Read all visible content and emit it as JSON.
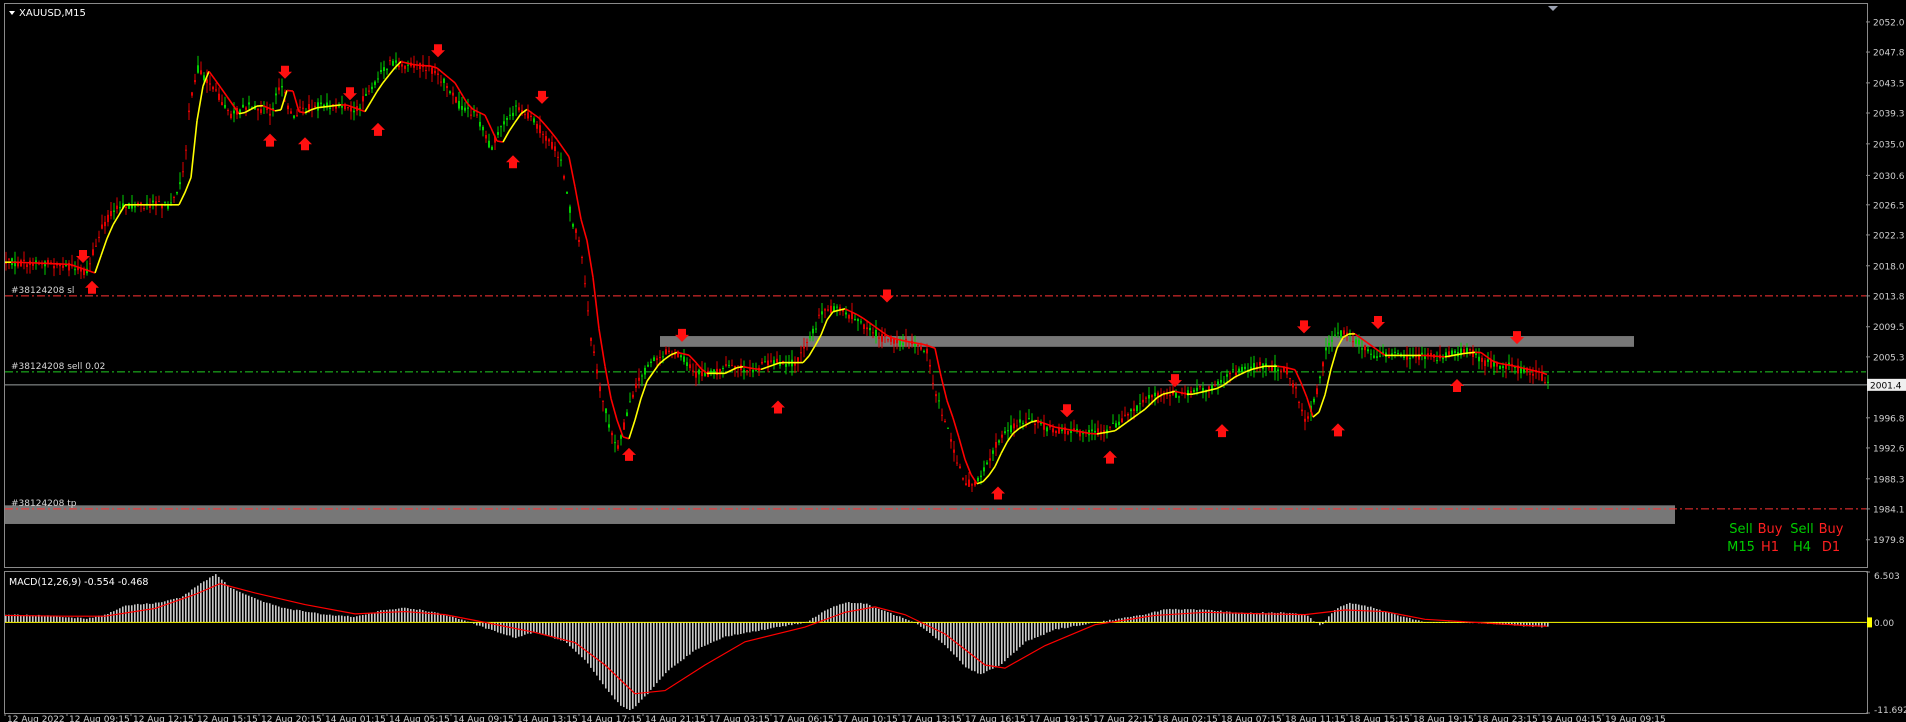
{
  "chart_data": [
    {
      "type": "candlestick",
      "symbol_label": "XAUUSD,M15",
      "ylim": [
        1976.0,
        2054.5
      ],
      "y_ticks": [
        "2052.0",
        "2047.8",
        "2043.5",
        "2039.3",
        "2035.0",
        "2030.6",
        "2026.5",
        "2022.3",
        "2018.0",
        "2013.8",
        "2009.5",
        "2005.3",
        "2001.4",
        "1996.8",
        "1992.6",
        "1988.3",
        "1984.1",
        "1979.8"
      ],
      "current_price_label": "2001.4",
      "x_ticks": [
        "12 Aug 2022",
        "12 Aug 09:15",
        "12 Aug 12:15",
        "12 Aug 15:15",
        "12 Aug 20:15",
        "14 Aug 01:15",
        "14 Aug 05:15",
        "14 Aug 09:15",
        "14 Aug 13:15",
        "14 Aug 17:15",
        "14 Aug 21:15",
        "17 Aug 03:15",
        "17 Aug 06:15",
        "17 Aug 10:15",
        "17 Aug 13:15",
        "17 Aug 16:15",
        "17 Aug 19:15",
        "17 Aug 22:15",
        "18 Aug 02:15",
        "18 Aug 07:15",
        "18 Aug 11:15",
        "18 Aug 15:15",
        "18 Aug 19:15",
        "18 Aug 23:15",
        "19 Aug 04:15",
        "19 Aug 09:15"
      ],
      "price_path": [
        [
          0,
          2018.5
        ],
        [
          55,
          2018.2
        ],
        [
          80,
          2017.0
        ],
        [
          95,
          2023.0
        ],
        [
          110,
          2026.5
        ],
        [
          165,
          2026.5
        ],
        [
          178,
          2031.0
        ],
        [
          183,
          2040.0
        ],
        [
          192,
          2045.5
        ],
        [
          205,
          2043.0
        ],
        [
          225,
          2039.0
        ],
        [
          245,
          2040.5
        ],
        [
          265,
          2039.3
        ],
        [
          275,
          2043.8
        ],
        [
          285,
          2039.0
        ],
        [
          300,
          2040.0
        ],
        [
          330,
          2040.5
        ],
        [
          350,
          2039.5
        ],
        [
          365,
          2043.0
        ],
        [
          385,
          2046.5
        ],
        [
          400,
          2046.0
        ],
        [
          420,
          2045.8
        ],
        [
          440,
          2043.5
        ],
        [
          455,
          2040.0
        ],
        [
          470,
          2039.0
        ],
        [
          485,
          2034.5
        ],
        [
          495,
          2037.0
        ],
        [
          510,
          2040.0
        ],
        [
          525,
          2038.5
        ],
        [
          540,
          2036.0
        ],
        [
          555,
          2033.0
        ],
        [
          565,
          2025.0
        ],
        [
          575,
          2020.0
        ],
        [
          585,
          2008.0
        ],
        [
          595,
          2000.0
        ],
        [
          605,
          1995.0
        ],
        [
          612,
          1993.0
        ],
        [
          620,
          1996.5
        ],
        [
          630,
          2001.5
        ],
        [
          645,
          2004.5
        ],
        [
          660,
          2006.0
        ],
        [
          675,
          2005.5
        ],
        [
          690,
          2003.0
        ],
        [
          710,
          2003.0
        ],
        [
          725,
          2004.0
        ],
        [
          745,
          2003.5
        ],
        [
          765,
          2004.5
        ],
        [
          790,
          2004.5
        ],
        [
          805,
          2008.0
        ],
        [
          815,
          2011.5
        ],
        [
          830,
          2012.0
        ],
        [
          845,
          2011.0
        ],
        [
          860,
          2009.5
        ],
        [
          875,
          2008.0
        ],
        [
          890,
          2007.5
        ],
        [
          910,
          2007.0
        ],
        [
          920,
          2006.5
        ],
        [
          930,
          2000.0
        ],
        [
          940,
          1996.0
        ],
        [
          950,
          1991.0
        ],
        [
          960,
          1987.5
        ],
        [
          970,
          1988.0
        ],
        [
          980,
          1990.0
        ],
        [
          990,
          1993.0
        ],
        [
          1000,
          1995.0
        ],
        [
          1020,
          1996.5
        ],
        [
          1040,
          1995.5
        ],
        [
          1060,
          1995.0
        ],
        [
          1080,
          1994.5
        ],
        [
          1100,
          1995.0
        ],
        [
          1115,
          1996.5
        ],
        [
          1130,
          1998.0
        ],
        [
          1145,
          2000.0
        ],
        [
          1160,
          2000.5
        ],
        [
          1175,
          2000.0
        ],
        [
          1190,
          2000.5
        ],
        [
          1205,
          2001.0
        ],
        [
          1220,
          2002.5
        ],
        [
          1235,
          2003.5
        ],
        [
          1250,
          2004.0
        ],
        [
          1265,
          2004.0
        ],
        [
          1280,
          2003.5
        ],
        [
          1290,
          2000.5
        ],
        [
          1300,
          1996.0
        ],
        [
          1310,
          2000.0
        ],
        [
          1320,
          2006.0
        ],
        [
          1330,
          2008.5
        ],
        [
          1340,
          2008.5
        ],
        [
          1355,
          2007.0
        ],
        [
          1370,
          2005.5
        ],
        [
          1390,
          2005.5
        ],
        [
          1410,
          2005.5
        ],
        [
          1430,
          2005.3
        ],
        [
          1450,
          2005.8
        ],
        [
          1465,
          2006.0
        ],
        [
          1480,
          2004.5
        ],
        [
          1500,
          2004.0
        ],
        [
          1515,
          2003.5
        ],
        [
          1530,
          2003.0
        ],
        [
          1542,
          2002.0
        ]
      ],
      "overlays": {
        "trend_line": {
          "color_up": "#FFFF00",
          "color_down": "#FF0000"
        },
        "zones": [
          {
            "y_top": 2008.2,
            "y_bottom": 2006.7
          },
          {
            "y_top": 1984.6,
            "y_bottom": 1982.0
          }
        ],
        "levels": [
          {
            "label": "#38124208 sl",
            "price": 2013.8,
            "color": "#FF3333",
            "style": "dashdot"
          },
          {
            "label": "#38124208 sell 0.02",
            "price": 2003.2,
            "color": "#22CC22",
            "style": "dashdot"
          },
          {
            "label": "",
            "price": 2001.4,
            "color": "#9AA0A0",
            "style": "solid"
          },
          {
            "label": "#38124208 tp",
            "price": 1984.1,
            "color": "#FF3333",
            "style": "dashdot"
          }
        ],
        "arrows_down": [
          {
            "t": 78,
            "p": 2018.8
          },
          {
            "t": 280,
            "p": 2044.5
          },
          {
            "t": 345,
            "p": 2041.5
          },
          {
            "t": 433,
            "p": 2047.5
          },
          {
            "t": 537,
            "p": 2041.0
          },
          {
            "t": 677,
            "p": 2007.8
          },
          {
            "t": 882,
            "p": 2013.3
          },
          {
            "t": 1062,
            "p": 1997.3
          },
          {
            "t": 1170,
            "p": 2001.5
          },
          {
            "t": 1299,
            "p": 2009.0
          },
          {
            "t": 1373,
            "p": 2009.6
          },
          {
            "t": 1512,
            "p": 2007.5
          }
        ],
        "arrows_up": [
          {
            "t": 87,
            "p": 2015.5
          },
          {
            "t": 265,
            "p": 2036.0
          },
          {
            "t": 300,
            "p": 2035.5
          },
          {
            "t": 373,
            "p": 2037.5
          },
          {
            "t": 508,
            "p": 2033.0
          },
          {
            "t": 624,
            "p": 1992.2
          },
          {
            "t": 773,
            "p": 1998.8
          },
          {
            "t": 993,
            "p": 1986.8
          },
          {
            "t": 1105,
            "p": 1991.8
          },
          {
            "t": 1217,
            "p": 1995.5
          },
          {
            "t": 1333,
            "p": 1995.6
          },
          {
            "t": 1452,
            "p": 2001.8
          }
        ]
      },
      "signals": {
        "row1": [
          {
            "text": "Sell",
            "color": "#00CC00"
          },
          {
            "text": "Buy",
            "color": "#FF2020"
          },
          {
            "text": "Sell",
            "color": "#00CC00"
          },
          {
            "text": "Buy",
            "color": "#FF2020"
          }
        ],
        "row2": [
          {
            "text": "M15",
            "color": "#00CC00"
          },
          {
            "text": "H1",
            "color": "#FF2020"
          },
          {
            "text": "H4",
            "color": "#00CC00"
          },
          {
            "text": "D1",
            "color": "#FF2020"
          }
        ]
      }
    },
    {
      "type": "histogram",
      "indicator_label": "MACD(12,26,9) -0.554 -0.468",
      "ylim": [
        -11.692,
        6.503
      ],
      "y_ticks": [
        "6.503",
        "0.00",
        "-11.692"
      ],
      "colors": {
        "histogram": "#C8C8C8",
        "signal": "#FF0000"
      },
      "macd_path": [
        [
          0,
          1.0
        ],
        [
          40,
          0.9
        ],
        [
          80,
          0.5
        ],
        [
          100,
          1.0
        ],
        [
          120,
          2.2
        ],
        [
          150,
          2.5
        ],
        [
          175,
          3.2
        ],
        [
          195,
          5.0
        ],
        [
          210,
          6.2
        ],
        [
          225,
          4.5
        ],
        [
          250,
          3.0
        ],
        [
          280,
          1.8
        ],
        [
          320,
          1.0
        ],
        [
          350,
          0.7
        ],
        [
          375,
          1.5
        ],
        [
          400,
          1.9
        ],
        [
          425,
          1.4
        ],
        [
          450,
          0.6
        ],
        [
          470,
          -0.3
        ],
        [
          490,
          -1.2
        ],
        [
          510,
          -2.0
        ],
        [
          530,
          -1.2
        ],
        [
          560,
          -2.5
        ],
        [
          580,
          -5.0
        ],
        [
          600,
          -8.5
        ],
        [
          615,
          -10.8
        ],
        [
          625,
          -11.4
        ],
        [
          640,
          -9.5
        ],
        [
          660,
          -6.5
        ],
        [
          690,
          -3.5
        ],
        [
          720,
          -1.8
        ],
        [
          760,
          -0.9
        ],
        [
          800,
          0.0
        ],
        [
          820,
          1.6
        ],
        [
          840,
          2.6
        ],
        [
          860,
          2.4
        ],
        [
          880,
          1.4
        ],
        [
          910,
          0.0
        ],
        [
          940,
          -3.0
        ],
        [
          960,
          -5.8
        ],
        [
          975,
          -6.7
        ],
        [
          995,
          -5.5
        ],
        [
          1020,
          -2.5
        ],
        [
          1050,
          -0.9
        ],
        [
          1090,
          0.0
        ],
        [
          1130,
          0.8
        ],
        [
          1160,
          1.7
        ],
        [
          1200,
          1.6
        ],
        [
          1240,
          1.2
        ],
        [
          1270,
          1.3
        ],
        [
          1300,
          1.0
        ],
        [
          1315,
          -0.5
        ],
        [
          1330,
          1.8
        ],
        [
          1345,
          2.5
        ],
        [
          1365,
          2.0
        ],
        [
          1390,
          1.0
        ],
        [
          1420,
          0.0
        ],
        [
          1460,
          0.0
        ],
        [
          1490,
          -0.2
        ],
        [
          1520,
          -0.5
        ],
        [
          1540,
          -0.6
        ]
      ],
      "signal_path": [
        [
          0,
          0.9
        ],
        [
          60,
          0.8
        ],
        [
          100,
          0.8
        ],
        [
          150,
          1.8
        ],
        [
          190,
          3.6
        ],
        [
          215,
          5.0
        ],
        [
          250,
          3.8
        ],
        [
          300,
          2.3
        ],
        [
          350,
          1.1
        ],
        [
          400,
          1.4
        ],
        [
          440,
          1.0
        ],
        [
          480,
          0.0
        ],
        [
          530,
          -1.3
        ],
        [
          570,
          -2.6
        ],
        [
          600,
          -5.5
        ],
        [
          630,
          -9.2
        ],
        [
          660,
          -8.8
        ],
        [
          700,
          -5.5
        ],
        [
          740,
          -2.5
        ],
        [
          800,
          -0.6
        ],
        [
          840,
          1.3
        ],
        [
          870,
          2.0
        ],
        [
          900,
          1.0
        ],
        [
          940,
          -1.5
        ],
        [
          980,
          -5.5
        ],
        [
          1000,
          -5.9
        ],
        [
          1040,
          -3.0
        ],
        [
          1090,
          -0.3
        ],
        [
          1150,
          0.9
        ],
        [
          1200,
          1.3
        ],
        [
          1260,
          1.1
        ],
        [
          1300,
          1.0
        ],
        [
          1340,
          1.6
        ],
        [
          1380,
          1.4
        ],
        [
          1420,
          0.4
        ],
        [
          1470,
          0.0
        ],
        [
          1520,
          -0.4
        ],
        [
          1542,
          -0.5
        ]
      ]
    }
  ]
}
